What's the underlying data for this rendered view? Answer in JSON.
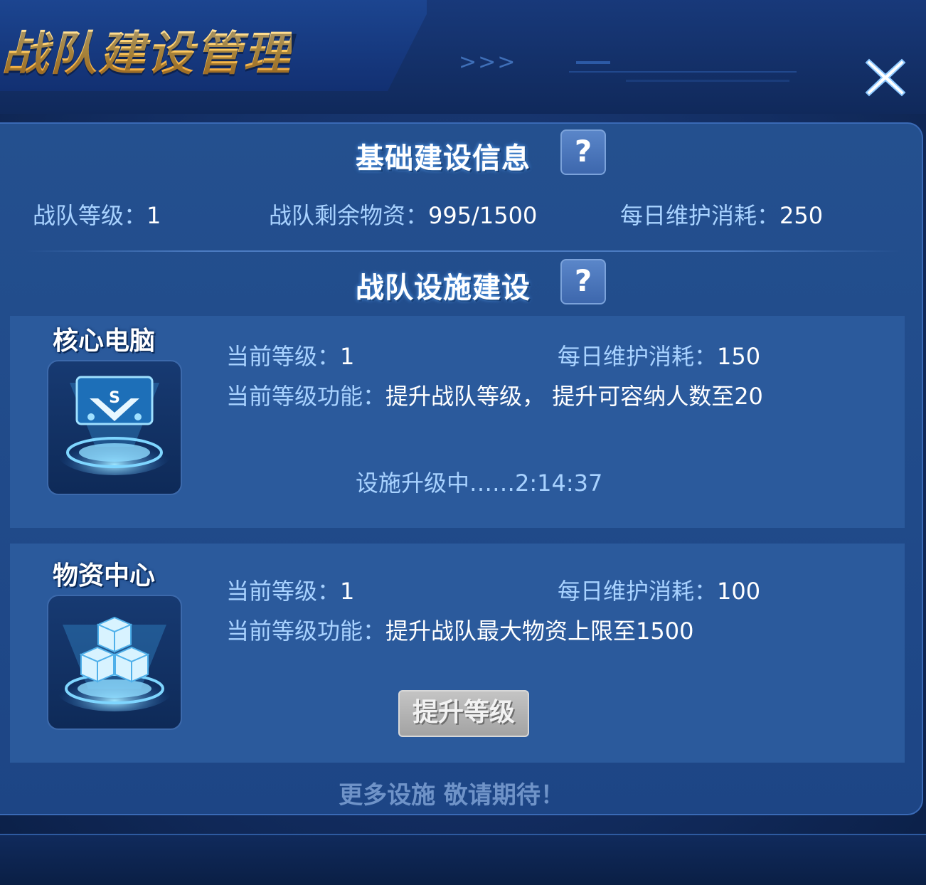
{
  "header": {
    "title": "战队建设管理",
    "arrows": ">>>"
  },
  "basic_info": {
    "section_title": "基础建设信息",
    "help_label": "?",
    "team_level_label": "战队等级：",
    "team_level_value": "1",
    "remaining_supplies_label": "战队剩余物资：",
    "remaining_supplies_value": "995/1500",
    "daily_upkeep_label": "每日维护消耗：",
    "daily_upkeep_value": "250"
  },
  "facility_section": {
    "section_title": "战队设施建设",
    "help_label": "?"
  },
  "facilities": [
    {
      "name": "核心电脑",
      "icon": "core-computer-icon",
      "level_label": "当前等级：",
      "level_value": "1",
      "upkeep_label": "每日维护消耗：",
      "upkeep_value": "150",
      "function_label": "当前等级功能：",
      "function_value": "提升战队等级， 提升可容纳人数至20",
      "status_text": "设施升级中……2:14:37"
    },
    {
      "name": "物资中心",
      "icon": "supply-center-icon",
      "level_label": "当前等级：",
      "level_value": "1",
      "upkeep_label": "每日维护消耗：",
      "upkeep_value": "100",
      "function_label": "当前等级功能：",
      "function_value": "提升战队最大物资上限至1500",
      "upgrade_button": "提升等级"
    }
  ],
  "footer": {
    "more_text": "更多设施 敬请期待！"
  },
  "colors": {
    "panel": "#24508f",
    "label": "#a8d2ff",
    "title_gold": "#ffc85a"
  }
}
